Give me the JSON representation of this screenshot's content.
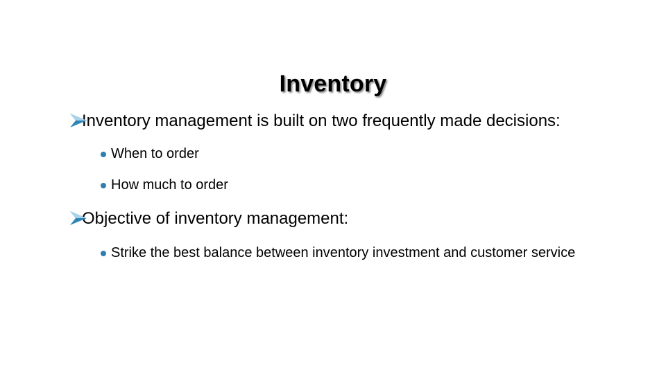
{
  "slide": {
    "title": "Inventory",
    "background_color": "#ffffff",
    "text_color": "#000000",
    "bullet_accent_color": "#2E7EB0",
    "bullets": [
      {
        "level": 1,
        "marker": "arrow-bullet-icon",
        "text": "Inventory management is built on two frequently made decisions:"
      },
      {
        "level": 2,
        "marker": "dot-bullet-icon",
        "text": "When to order"
      },
      {
        "level": 2,
        "marker": "dot-bullet-icon",
        "text": "How much to order"
      },
      {
        "level": 1,
        "marker": "arrow-bullet-icon",
        "text": "Objective of inventory management:"
      },
      {
        "level": 2,
        "marker": "dot-bullet-icon",
        "text": "Strike the best balance between inventory investment and customer service"
      }
    ]
  }
}
